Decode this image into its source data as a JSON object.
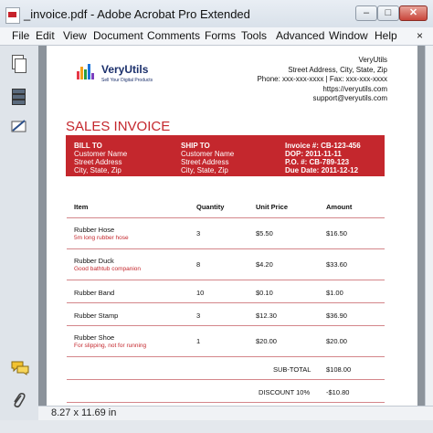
{
  "window": {
    "title": "_invoice.pdf - Adobe Acrobat Pro Extended",
    "min_label": "–",
    "max_label": "□",
    "close_label": "✕"
  },
  "menu": [
    "File",
    "Edit",
    "View",
    "Document",
    "Comments",
    "Forms",
    "Tools",
    "Advanced",
    "Window",
    "Help"
  ],
  "menu_close": "×",
  "status": {
    "page_size": "8.27 x 11.69 in"
  },
  "icons": {
    "app": "pdf-file-icon",
    "pages": "pages-icon",
    "layers": "layers-icon",
    "sign": "signature-icon",
    "comments": "comments-icon",
    "attachments": "paperclip-icon"
  },
  "colors": {
    "accent_red": "#c4272d",
    "brand_blue": "#1a2f6b"
  },
  "invoice": {
    "company_logo": "VeryUtils",
    "company_tagline": "Sell Your Digital Products",
    "company": {
      "name": "VeryUtils",
      "address": "Street Address, City, State, Zip",
      "phone": "Phone: xxx-xxx-xxxx | Fax: xxx-xxx-xxxx",
      "website": "https://veryutils.com",
      "email": "support@veryutils.com"
    },
    "title": "SALES INVOICE",
    "bill_to": {
      "heading": "BILL TO",
      "name": "Customer Name",
      "street": "Street Address",
      "city": "City, State, Zip"
    },
    "ship_to": {
      "heading": "SHIP TO",
      "name": "Customer Name",
      "street": "Street Address",
      "city": "City, State, Zip"
    },
    "meta": {
      "invoice_no": "Invoice #: CB-123-456",
      "dop": "DOP: 2011-11-11",
      "po": "P.O. #: CB-789-123",
      "due": "Due Date: 2011-12-12"
    },
    "headers": {
      "item": "Item",
      "quantity": "Quantity",
      "unit_price": "Unit Price",
      "amount": "Amount"
    },
    "rows": [
      {
        "item": "Rubber Hose",
        "desc": "5m long rubber hose",
        "qty": "3",
        "price": "$5.50",
        "amount": "$16.50"
      },
      {
        "item": "Rubber Duck",
        "desc": "Good bathtub companion",
        "qty": "8",
        "price": "$4.20",
        "amount": "$33.60"
      },
      {
        "item": "Rubber Band",
        "desc": "",
        "qty": "10",
        "price": "$0.10",
        "amount": "$1.00"
      },
      {
        "item": "Rubber Stamp",
        "desc": "",
        "qty": "3",
        "price": "$12.30",
        "amount": "$36.90"
      },
      {
        "item": "Rubber Shoe",
        "desc": "For slipping, not for running",
        "qty": "1",
        "price": "$20.00",
        "amount": "$20.00"
      }
    ],
    "subtotal": {
      "label": "SUB-TOTAL",
      "value": "$108.00"
    },
    "discount": {
      "label": "DISCOUNT 10%",
      "value": "-$10.80"
    }
  }
}
